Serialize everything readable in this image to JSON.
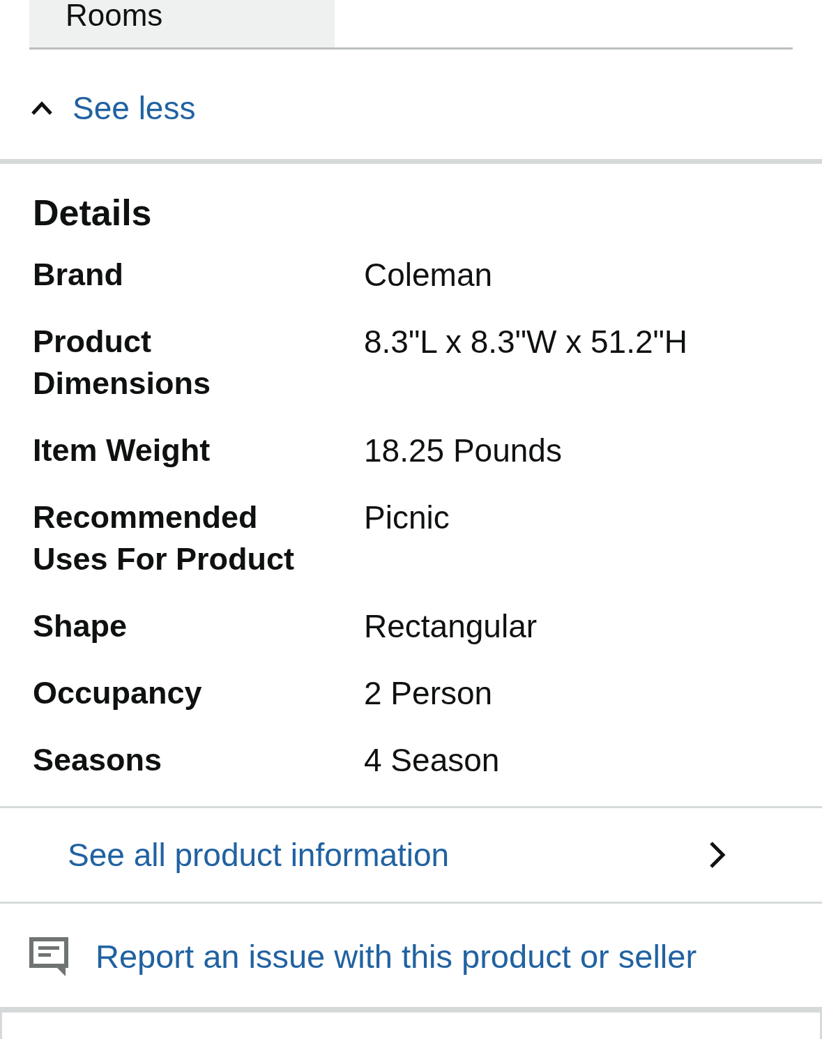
{
  "spec_table": {
    "last_row_label": "Rooms"
  },
  "toggle": {
    "label": "See less",
    "expanded": true
  },
  "details": {
    "title": "Details",
    "rows": [
      {
        "label": "Brand",
        "value": "Coleman"
      },
      {
        "label": "Product Dimensions",
        "value": "8.3\"L x 8.3\"W x 51.2\"H"
      },
      {
        "label": "Item Weight",
        "value": "18.25 Pounds"
      },
      {
        "label": "Recommended Uses For Product",
        "value": "Picnic"
      },
      {
        "label": "Shape",
        "value": "Rectangular"
      },
      {
        "label": "Occupancy",
        "value": "2 Person"
      },
      {
        "label": "Seasons",
        "value": "4 Season"
      }
    ]
  },
  "see_all_link": {
    "label": "See all product information"
  },
  "report_link": {
    "label": "Report an issue with this product or seller"
  }
}
